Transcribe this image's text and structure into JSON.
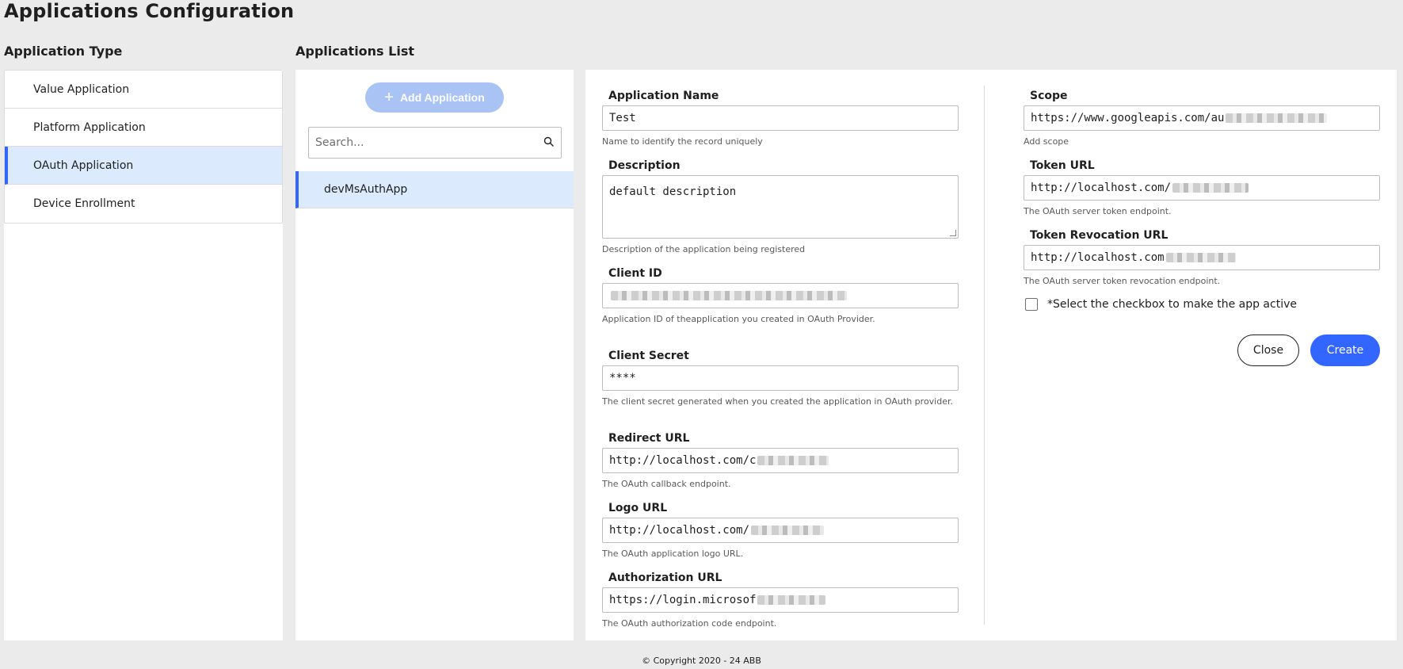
{
  "page": {
    "title": "Applications Configuration"
  },
  "type_section": {
    "title": "Application Type",
    "items": [
      {
        "label": "Value Application",
        "selected": false
      },
      {
        "label": "Platform Application",
        "selected": false
      },
      {
        "label": "OAuth Application",
        "selected": true
      },
      {
        "label": "Device Enrollment",
        "selected": false
      }
    ]
  },
  "apps_section": {
    "title": "Applications List",
    "add_button": "Add Application",
    "search_placeholder": "Search...",
    "items": [
      {
        "label": "devMsAuthApp",
        "selected": true
      }
    ]
  },
  "form": {
    "application_name": {
      "label": "Application Name",
      "value": "Test",
      "hint": "Name to identify the record uniquely"
    },
    "description": {
      "label": "Description",
      "value": "default description",
      "hint": "Description of the application being registered"
    },
    "client_id": {
      "label": "Client ID",
      "value": "",
      "hint": "Application ID of theapplication you created in OAuth Provider."
    },
    "client_secret": {
      "label": "Client Secret",
      "value": "****",
      "hint": "The client secret generated when you created the application in OAuth provider."
    },
    "redirect_url": {
      "label": "Redirect URL",
      "value": "http://localhost.com/c",
      "hint": "The OAuth callback endpoint."
    },
    "logo_url": {
      "label": "Logo URL",
      "value": "http://localhost.com/",
      "hint": "The OAuth application logo URL."
    },
    "authorization_url": {
      "label": "Authorization URL",
      "value": "https://login.microsof",
      "hint": "The OAuth authorization code endpoint."
    },
    "scope": {
      "label": "Scope",
      "value": "https://www.googleapis.com/au",
      "hint": "Add scope"
    },
    "token_url": {
      "label": "Token URL",
      "value": "http://localhost.com/",
      "hint": "The OAuth server token endpoint."
    },
    "token_revocation_url": {
      "label": "Token Revocation URL",
      "value": "http://localhost.com",
      "hint": "The OAuth server token revocation endpoint."
    },
    "active_checkbox": {
      "label": "*Select the checkbox to make the app active",
      "checked": false
    },
    "close_button": "Close",
    "create_button": "Create"
  },
  "footer": {
    "copyright": "© Copyright 2020 - 24 ABB"
  },
  "colors": {
    "accent": "#3366ff",
    "selected_bg": "#dbeafd",
    "add_button_disabled": "#a9c3f5",
    "page_bg": "#ebebeb"
  }
}
